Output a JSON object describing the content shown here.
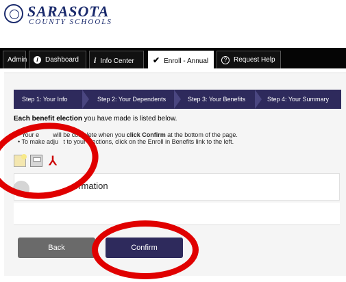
{
  "logo": {
    "name_top": "SARASOTA",
    "name_bottom": "COUNTY SCHOOLS"
  },
  "nav": {
    "tabs": [
      {
        "label": "Admin",
        "icon": "none"
      },
      {
        "label": "Dashboard",
        "icon": "info-circle-icon"
      },
      {
        "label": "Info Center",
        "icon": "info-italic-icon"
      },
      {
        "label": "Enroll - Annual",
        "icon": "checkmark-icon"
      },
      {
        "label": "Request Help",
        "icon": "question-circle-icon"
      }
    ],
    "active_tab": "Enroll - Annual"
  },
  "steps": [
    {
      "label": "Step 1: Your Info"
    },
    {
      "label": "Step 2: Your Dependents"
    },
    {
      "label": "Step 3: Your Benefits"
    },
    {
      "label": "Step 4: Your Summary"
    }
  ],
  "intro": {
    "bold": "Each benefit election",
    "rest": " you have made is listed below."
  },
  "notes": {
    "line1_a": "• Your e",
    "line1_b": "will be complete when you ",
    "line1_bold": "click Confirm",
    "line1_c": " at the bottom of the page.",
    "line2_a": "• To make adju",
    "line2_b": "t to your elections, click on the Enroll in Benefits link to the left."
  },
  "action_icons": [
    "email-icon",
    "print-icon",
    "pdf-icon"
  ],
  "section": {
    "title": "ormation"
  },
  "buttons": {
    "back": "Back",
    "confirm": "Confirm"
  },
  "colors": {
    "navbar": "#050505",
    "steps": "#2e2a5c",
    "confirm": "#2e2a5c",
    "back": "#6a6a6a",
    "annotation": "#e00000",
    "logo": "#1a2a6c"
  }
}
